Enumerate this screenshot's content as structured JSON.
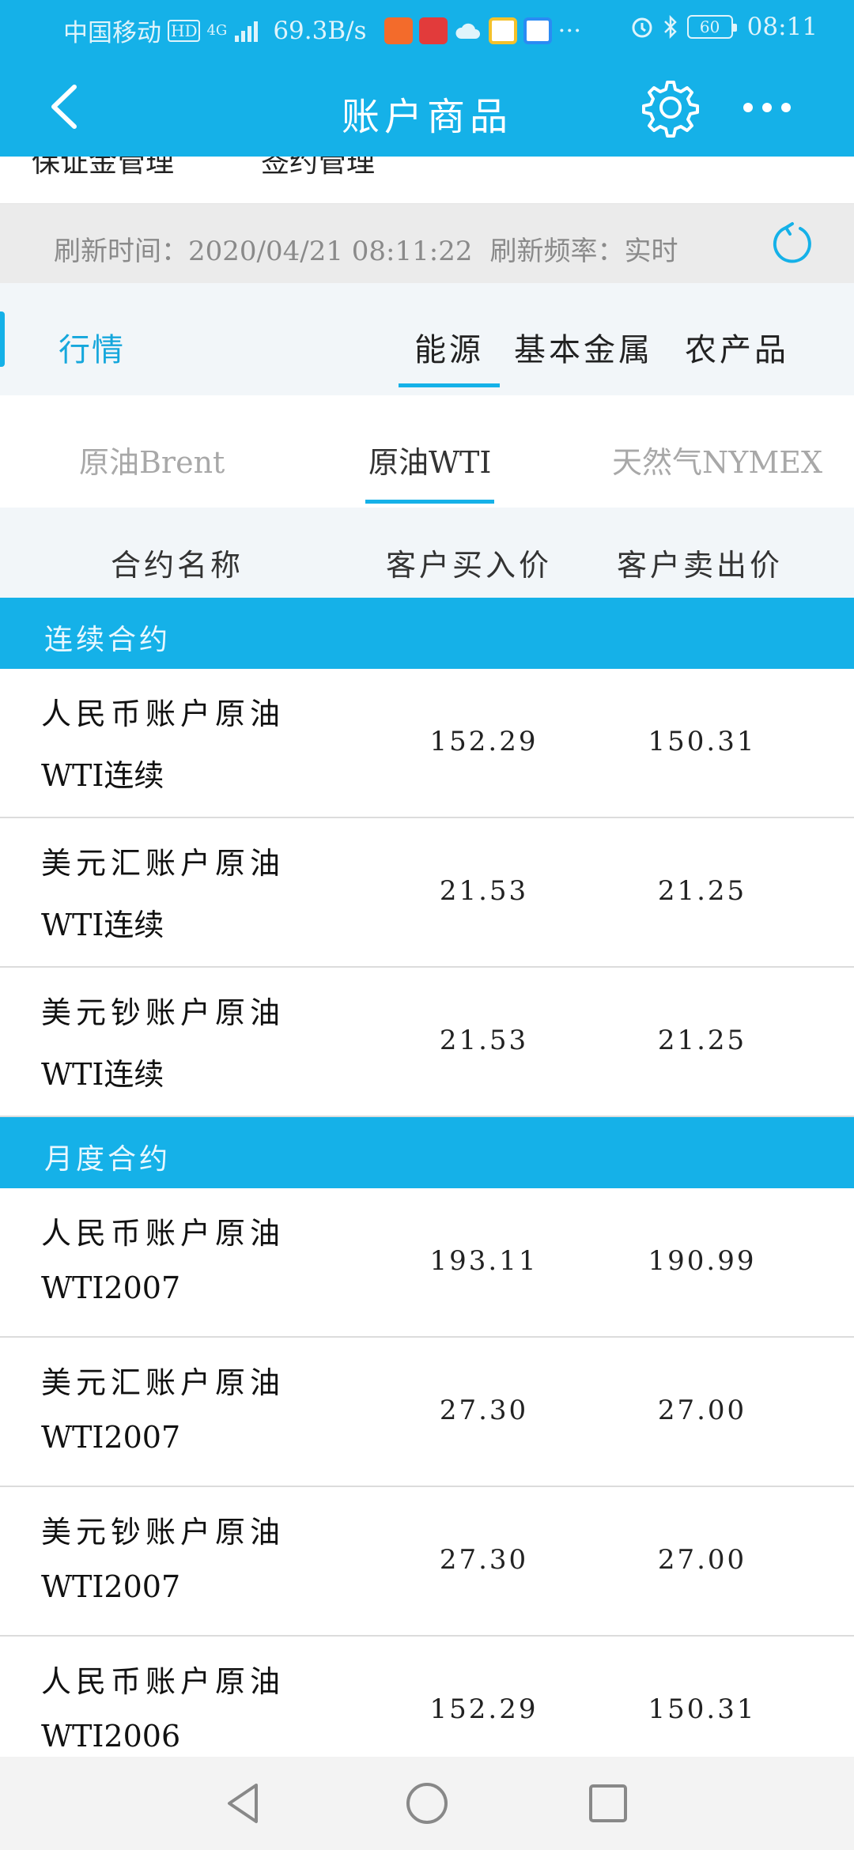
{
  "status_bar": {
    "carrier": "中国移动",
    "hd": "HD",
    "network": "4G",
    "speed": "69.3B/s",
    "more": "···",
    "battery": "60",
    "time": "08:11"
  },
  "header": {
    "title": "账户商品"
  },
  "top_tabs": [
    "保证金管理",
    "签约管理"
  ],
  "refresh": {
    "time_label": "刷新时间：",
    "time_value": "2020/04/21 08:11:22",
    "freq_label": "刷新频率：",
    "freq_value": "实时"
  },
  "category": {
    "label": "行情",
    "tabs": [
      "能源",
      "基本金属",
      "农产品"
    ],
    "active": "能源"
  },
  "sub_tabs": [
    "原油Brent",
    "原油WTI",
    "天然气NYMEX"
  ],
  "table": {
    "columns": [
      "合约名称",
      "客户买入价",
      "客户卖出价"
    ],
    "sections": [
      {
        "title": "连续合约",
        "rows": [
          {
            "name_line1": "人民币账户原油",
            "name_line2": "WTI连续",
            "buy": "152.29",
            "sell": "150.31"
          },
          {
            "name_line1": "美元汇账户原油",
            "name_line2": "WTI连续",
            "buy": "21.53",
            "sell": "21.25"
          },
          {
            "name_line1": "美元钞账户原油",
            "name_line2": "WTI连续",
            "buy": "21.53",
            "sell": "21.25"
          }
        ]
      },
      {
        "title": "月度合约",
        "rows": [
          {
            "name_line1": "人民币账户原油",
            "name_line2": "WTI2007",
            "buy": "193.11",
            "sell": "190.99"
          },
          {
            "name_line1": "美元汇账户原油",
            "name_line2": "WTI2007",
            "buy": "27.30",
            "sell": "27.00"
          },
          {
            "name_line1": "美元钞账户原油",
            "name_line2": "WTI2007",
            "buy": "27.30",
            "sell": "27.00"
          },
          {
            "name_line1": "人民币账户原油",
            "name_line2": "WTI2006",
            "buy": "152.29",
            "sell": "150.31"
          }
        ]
      }
    ]
  },
  "colors": {
    "accent": "#15b1e8",
    "header_bg": "#15b1e8",
    "refresh_bg": "#ebebeb",
    "category_bg": "#f2f6f9"
  }
}
